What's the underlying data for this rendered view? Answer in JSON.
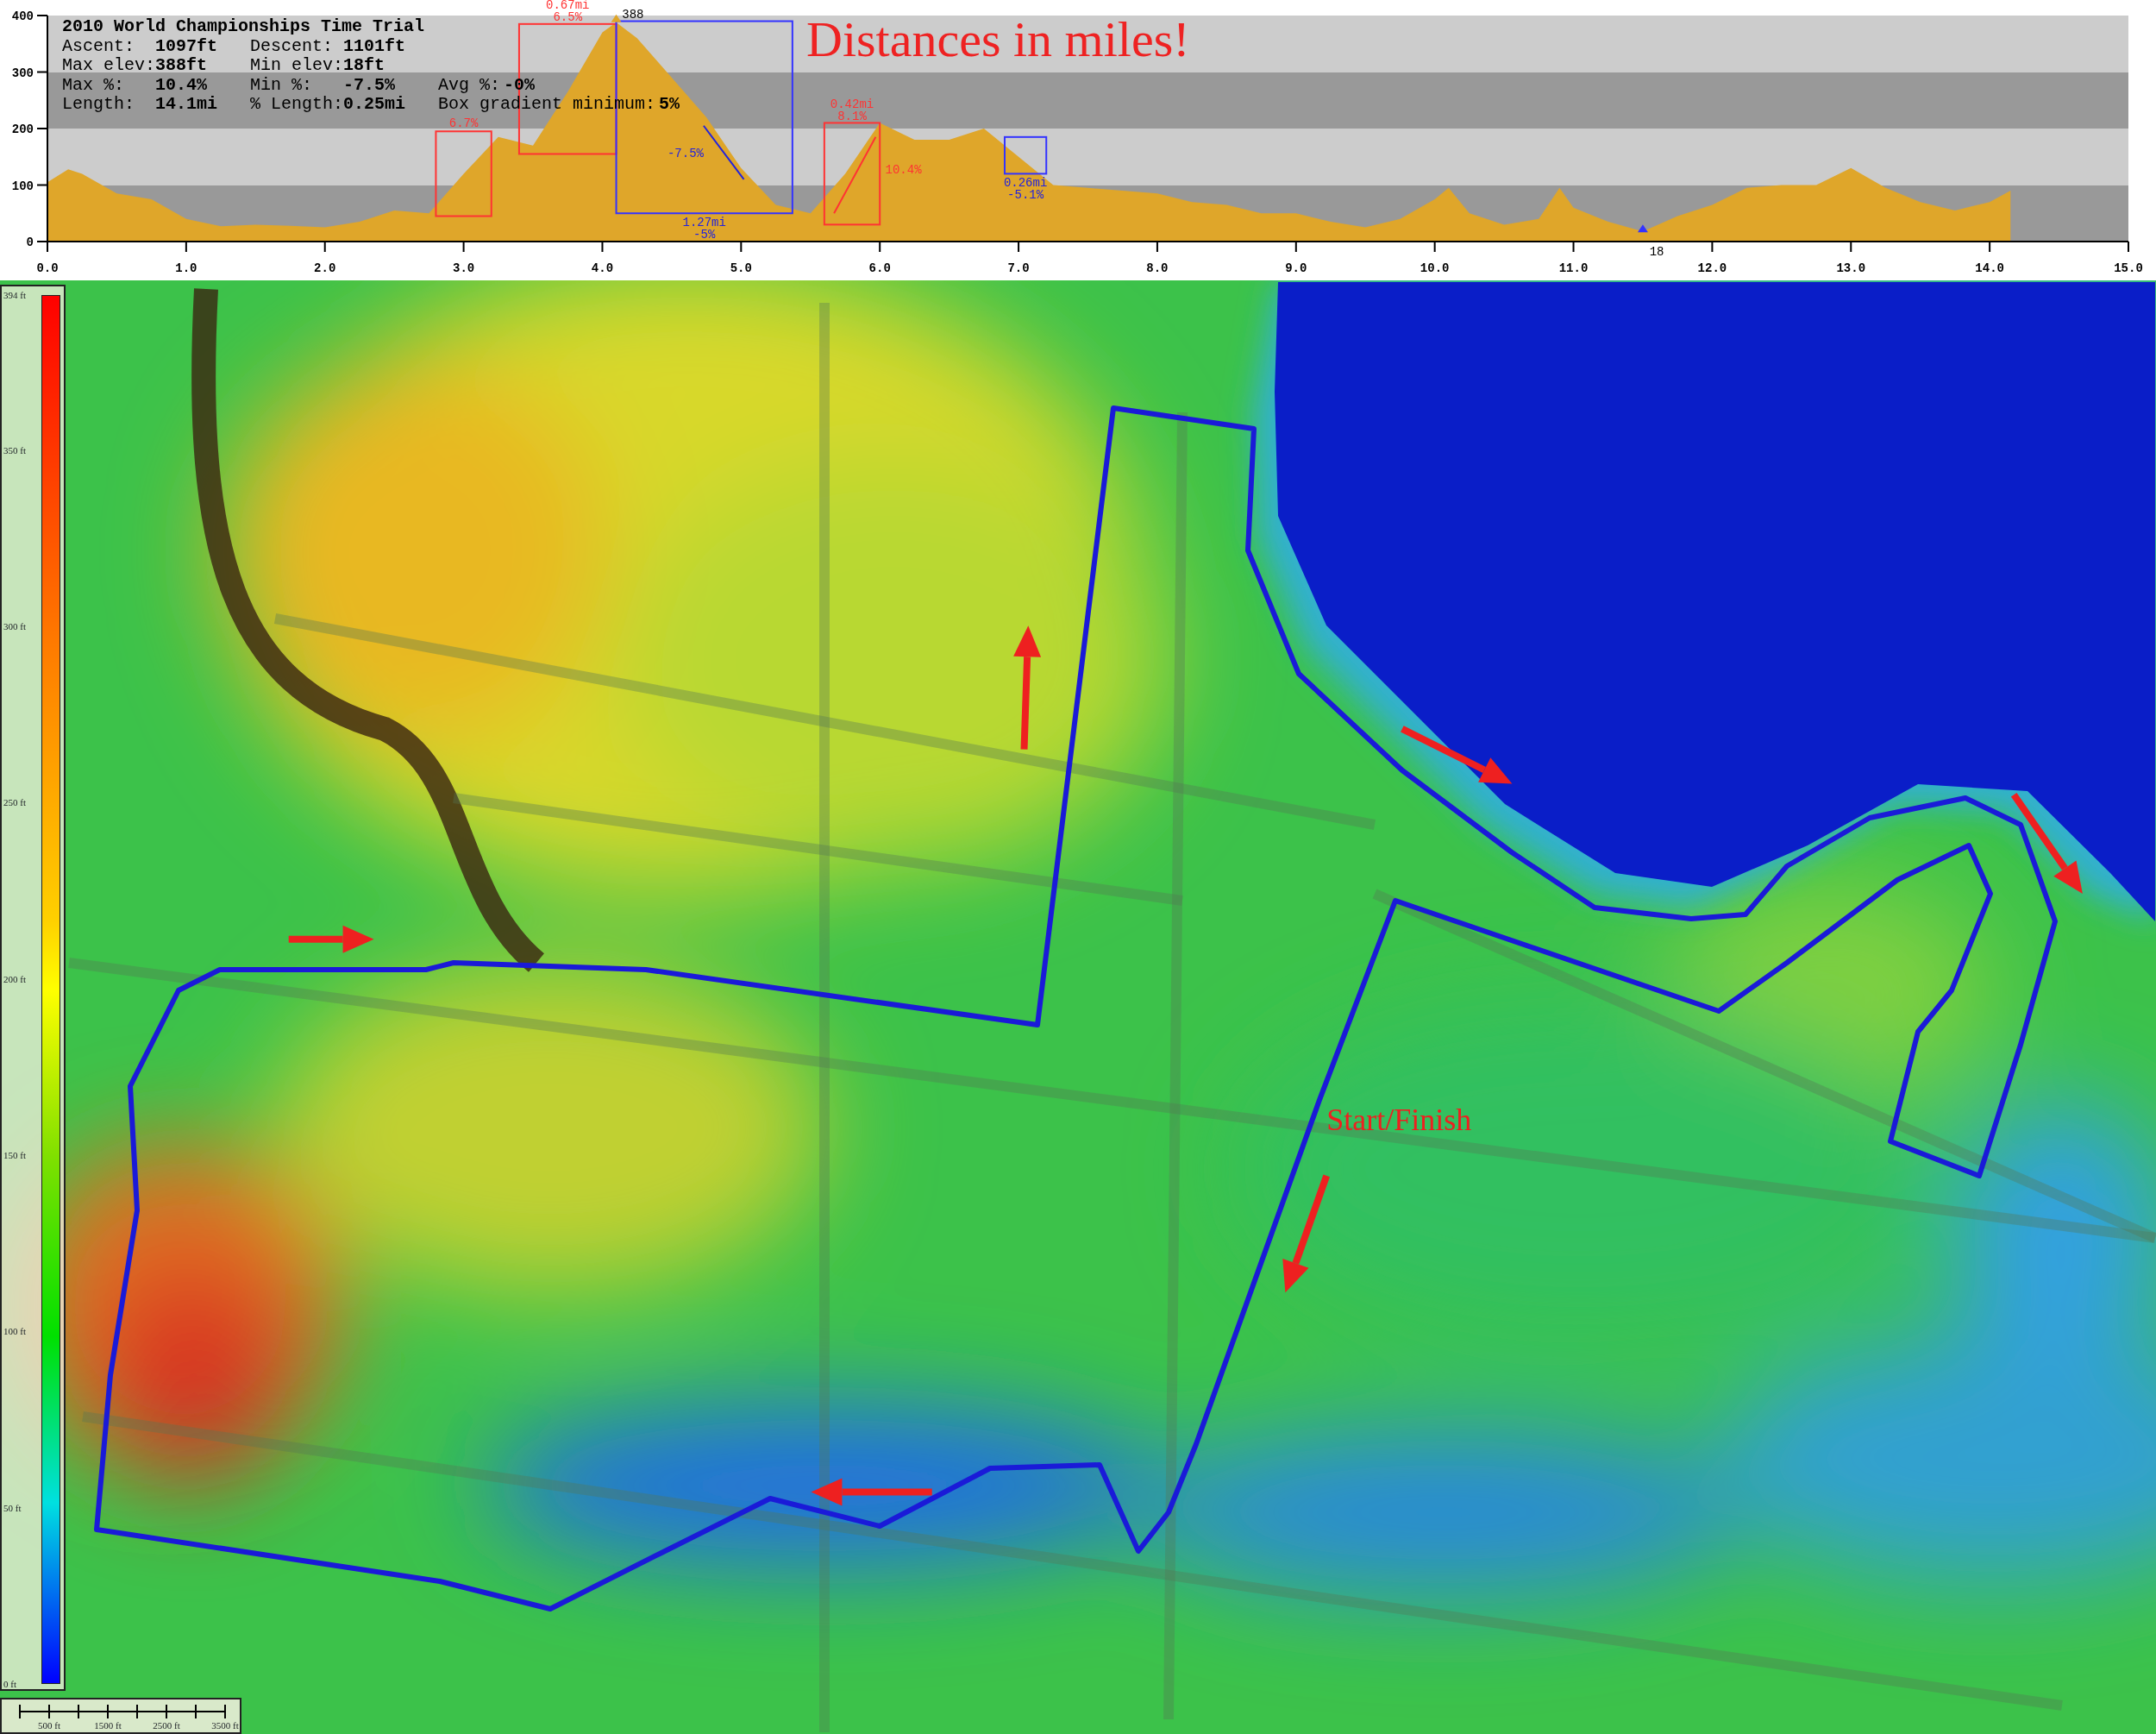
{
  "profile": {
    "stats": {
      "title": "2010 World Championships Time Trial",
      "rows": [
        [
          {
            "label": "Ascent:",
            "value": "1097ft"
          },
          {
            "label": "Descent:",
            "value": "1101ft"
          }
        ],
        [
          {
            "label": "Max elev:",
            "value": "388ft"
          },
          {
            "label": "Min elev:",
            "value": "18ft"
          }
        ],
        [
          {
            "label": "Max %:",
            "value": "10.4%"
          },
          {
            "label": "Min %:",
            "value": "-7.5%"
          },
          {
            "label": "Avg %:",
            "value": "-0%"
          }
        ],
        [
          {
            "label": "Length:",
            "value": "14.1mi"
          },
          {
            "label": "% Length:",
            "value": "0.25mi"
          },
          {
            "label": "Box gradient minimum:",
            "value": "5%"
          }
        ]
      ]
    },
    "note": "Distances in miles!",
    "chart_data": {
      "type": "area",
      "x": [
        0,
        0.15,
        0.25,
        0.5,
        0.75,
        1,
        1.25,
        1.5,
        1.75,
        2,
        2.25,
        2.5,
        2.75,
        3,
        3.25,
        3.5,
        3.75,
        4,
        4.1,
        4.25,
        4.5,
        4.75,
        5,
        5.25,
        5.5,
        5.75,
        6,
        6.25,
        6.5,
        6.75,
        7,
        7.25,
        7.5,
        7.75,
        8,
        8.25,
        8.5,
        8.75,
        9,
        9.25,
        9.5,
        9.75,
        10,
        10.1,
        10.25,
        10.5,
        10.75,
        10.9,
        11,
        11.25,
        11.5,
        11.75,
        12,
        12.25,
        12.5,
        12.75,
        13,
        13.25,
        13.5,
        13.75,
        14,
        14.15
      ],
      "series": [
        {
          "color": "#dfa62a",
          "values": [
            105,
            128,
            120,
            85,
            75,
            40,
            27,
            30,
            28,
            25,
            35,
            55,
            50,
            120,
            185,
            170,
            265,
            370,
            388,
            360,
            290,
            220,
            130,
            65,
            50,
            120,
            210,
            180,
            180,
            200,
            150,
            100,
            95,
            90,
            85,
            70,
            65,
            50,
            50,
            35,
            25,
            40,
            75,
            95,
            50,
            30,
            40,
            95,
            60,
            35,
            18,
            45,
            65,
            95,
            100,
            100,
            130,
            95,
            70,
            55,
            70,
            90
          ]
        }
      ],
      "xlim": [
        0,
        15
      ],
      "ylim": [
        0,
        400
      ],
      "xticks": [
        {
          "value": 0,
          "label": "0.0"
        },
        {
          "value": 1,
          "label": "1.0"
        },
        {
          "value": 2,
          "label": "2.0"
        },
        {
          "value": 3,
          "label": "3.0"
        },
        {
          "value": 4,
          "label": "4.0"
        },
        {
          "value": 5,
          "label": "5.0"
        },
        {
          "value": 6,
          "label": "6.0"
        },
        {
          "value": 7,
          "label": "7.0"
        },
        {
          "value": 8,
          "label": "8.0"
        },
        {
          "value": 9,
          "label": "9.0"
        },
        {
          "value": 10,
          "label": "10.0"
        },
        {
          "value": 11,
          "label": "11.0"
        },
        {
          "value": 12,
          "label": "12.0"
        },
        {
          "value": 13,
          "label": "13.0"
        },
        {
          "value": 14,
          "label": "14.0"
        },
        {
          "value": 15,
          "label": "15.0"
        }
      ],
      "yticks": [
        0,
        100,
        200,
        300,
        400
      ],
      "annotations": [
        "6.7%",
        "0.67mi",
        "6.5%",
        "-7.5%",
        "1.27mi",
        "-5%",
        "0.42mi",
        "8.1%",
        "10.4%",
        "0.26mi",
        "-5.1%",
        "388",
        "18"
      ]
    }
  },
  "map": {
    "labels": [
      {
        "text": "Start/Finish"
      }
    ],
    "legend": {
      "labels": [
        "394 ft",
        "350 ft",
        "300 ft",
        "250 ft",
        "200 ft",
        "150 ft",
        "100 ft",
        "50 ft",
        "0 ft"
      ]
    },
    "scale_bar": {
      "labels": [
        "500 ft",
        "1500 ft",
        "2500 ft",
        "3500 ft"
      ]
    }
  }
}
